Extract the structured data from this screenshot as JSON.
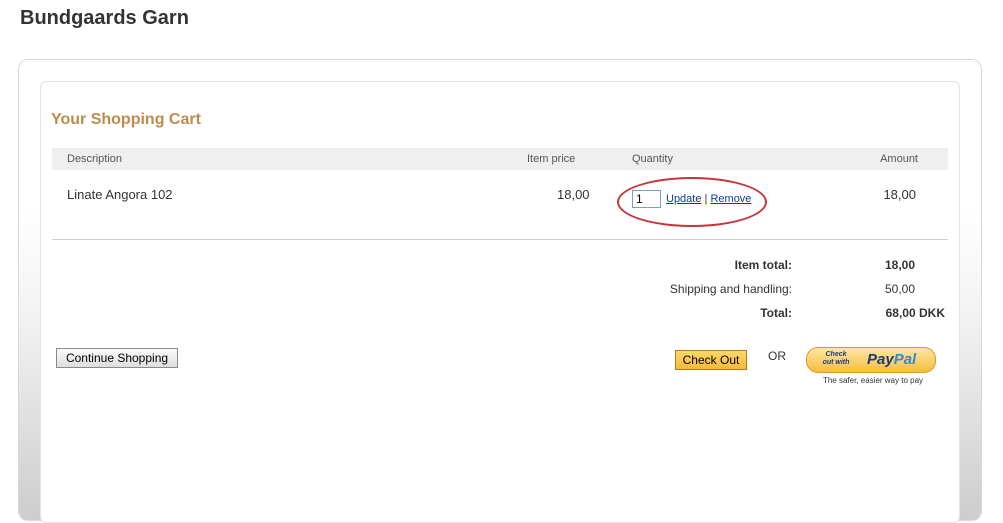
{
  "site": {
    "title": "Bundgaards Garn"
  },
  "cart": {
    "title": "Your Shopping Cart",
    "columns": {
      "description": "Description",
      "item_price": "Item price",
      "quantity": "Quantity",
      "amount": "Amount"
    },
    "items": [
      {
        "description": "Linate Angora 102",
        "item_price": "18,00",
        "quantity": "1",
        "update_label": "Update",
        "separator": "|",
        "remove_label": "Remove",
        "amount": "18,00"
      }
    ],
    "totals": {
      "item_total_label": "Item total:",
      "item_total_value": "18,00",
      "shipping_label": "Shipping and handling:",
      "shipping_value": "50,00",
      "total_label": "Total:",
      "total_value": "68,00 DKK"
    },
    "actions": {
      "continue_label": "Continue Shopping",
      "checkout_label": "Check Out",
      "or_label": "OR",
      "paypal_small": "Check out with",
      "paypal_brand_a": "Pay",
      "paypal_brand_b": "Pal",
      "paypal_tagline": "The safer, easier way to pay"
    }
  },
  "colors": {
    "accent": "#c08b4a",
    "highlight_ellipse": "#c8323a",
    "link": "#0b3f9a"
  }
}
